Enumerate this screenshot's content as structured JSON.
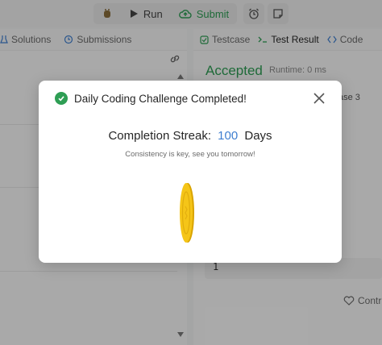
{
  "toolbar": {
    "run_label": "Run",
    "submit_label": "Submit"
  },
  "left_panel": {
    "tabs": [
      {
        "label": "Solutions"
      },
      {
        "label": "Submissions"
      }
    ]
  },
  "right_panel": {
    "tabs": [
      {
        "label": "Testcase"
      },
      {
        "label": "Test Result"
      },
      {
        "label": "Code"
      }
    ],
    "status": "Accepted",
    "runtime": "Runtime: 0 ms",
    "case_peek": "ase 3",
    "output_value": "1",
    "contribute_label": "Contri"
  },
  "modal": {
    "title": "Daily Coding Challenge Completed!",
    "streak_label": "Completion Streak:",
    "streak_count": "100",
    "streak_unit": "Days",
    "tagline": "Consistency is key, see you tomorrow!"
  },
  "colors": {
    "accent_green": "#2e9e54",
    "streak_blue": "#3f7fd0",
    "coin_gold": "#f5c518"
  }
}
